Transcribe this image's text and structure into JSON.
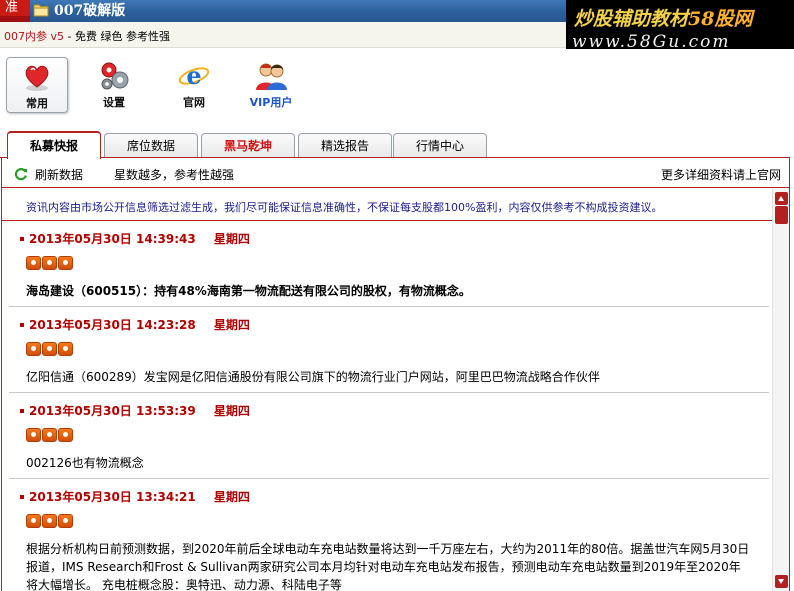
{
  "window": {
    "corner_tab": "准",
    "title": "007破解版"
  },
  "watermark": {
    "line1_prefix": "炒股辅助教材",
    "line1_site": "58股网",
    "line2": "www.58Gu.com"
  },
  "subtitle": {
    "brand": "007内参 v5",
    "tagline": " - 免费 绿色 参考性强"
  },
  "toolbar": {
    "items": [
      {
        "label": "常用",
        "icon": "heart-icon",
        "active": true
      },
      {
        "label": "设置",
        "icon": "gears-icon",
        "active": false
      },
      {
        "label": "官网",
        "icon": "ie-icon",
        "active": false
      },
      {
        "label": "VIP用户",
        "icon": "users-icon",
        "active": false
      }
    ]
  },
  "tabs": [
    {
      "label": "私募快报",
      "active": true
    },
    {
      "label": "席位数据",
      "active": false
    },
    {
      "label": "黑马乾坤",
      "active": false,
      "highlight": true
    },
    {
      "label": "精选报告",
      "active": false
    },
    {
      "label": "行情中心",
      "active": false
    }
  ],
  "infobar": {
    "refresh": "刷新数据",
    "stars_note": "星数越多，参考性越强",
    "more": "更多详细资料请上官网"
  },
  "disclaimer": "资讯内容由市场公开信息筛选过滤生成，我们尽可能保证信息准确性，不保证每支股都100%盈利，内容仅供参考不构成投资建议。",
  "news": [
    {
      "date": "2013年05月30日",
      "time": "14:39:43",
      "weekday": "星期四",
      "stars": 3,
      "bold": true,
      "text": "海岛建设（600515）：持有48%海南第一物流配送有限公司的股权，有物流概念。"
    },
    {
      "date": "2013年05月30日",
      "time": "14:23:28",
      "weekday": "星期四",
      "stars": 3,
      "bold": false,
      "text": "亿阳信通（600289）发宝网是亿阳信通股份有限公司旗下的物流行业门户网站，阿里巴巴物流战略合作伙伴"
    },
    {
      "date": "2013年05月30日",
      "time": "13:53:39",
      "weekday": "星期四",
      "stars": 3,
      "bold": false,
      "text": "002126也有物流概念"
    },
    {
      "date": "2013年05月30日",
      "time": "13:34:21",
      "weekday": "星期四",
      "stars": 3,
      "bold": false,
      "text": "根据分析机构日前预测数据，到2020年前后全球电动车充电站数量将达到一千万座左右，大约为2011年的80倍。据盖世汽车网5月30日报道，IMS Research和Frost & Sullivan两家研究公司本月均针对电动车充电站发布报告，预测电动车充电站数量到2019年至2020年将大幅增长。  充电桩概念股：奥特迅、动力源、科陆电子等"
    }
  ],
  "colors": {
    "accent_red": "#b32020",
    "timestamp_red": "#b00000",
    "disclaimer_blue": "#1c1c8c",
    "titlebar_blue": "#2c5f9a",
    "star_orange": "#e8620f"
  }
}
